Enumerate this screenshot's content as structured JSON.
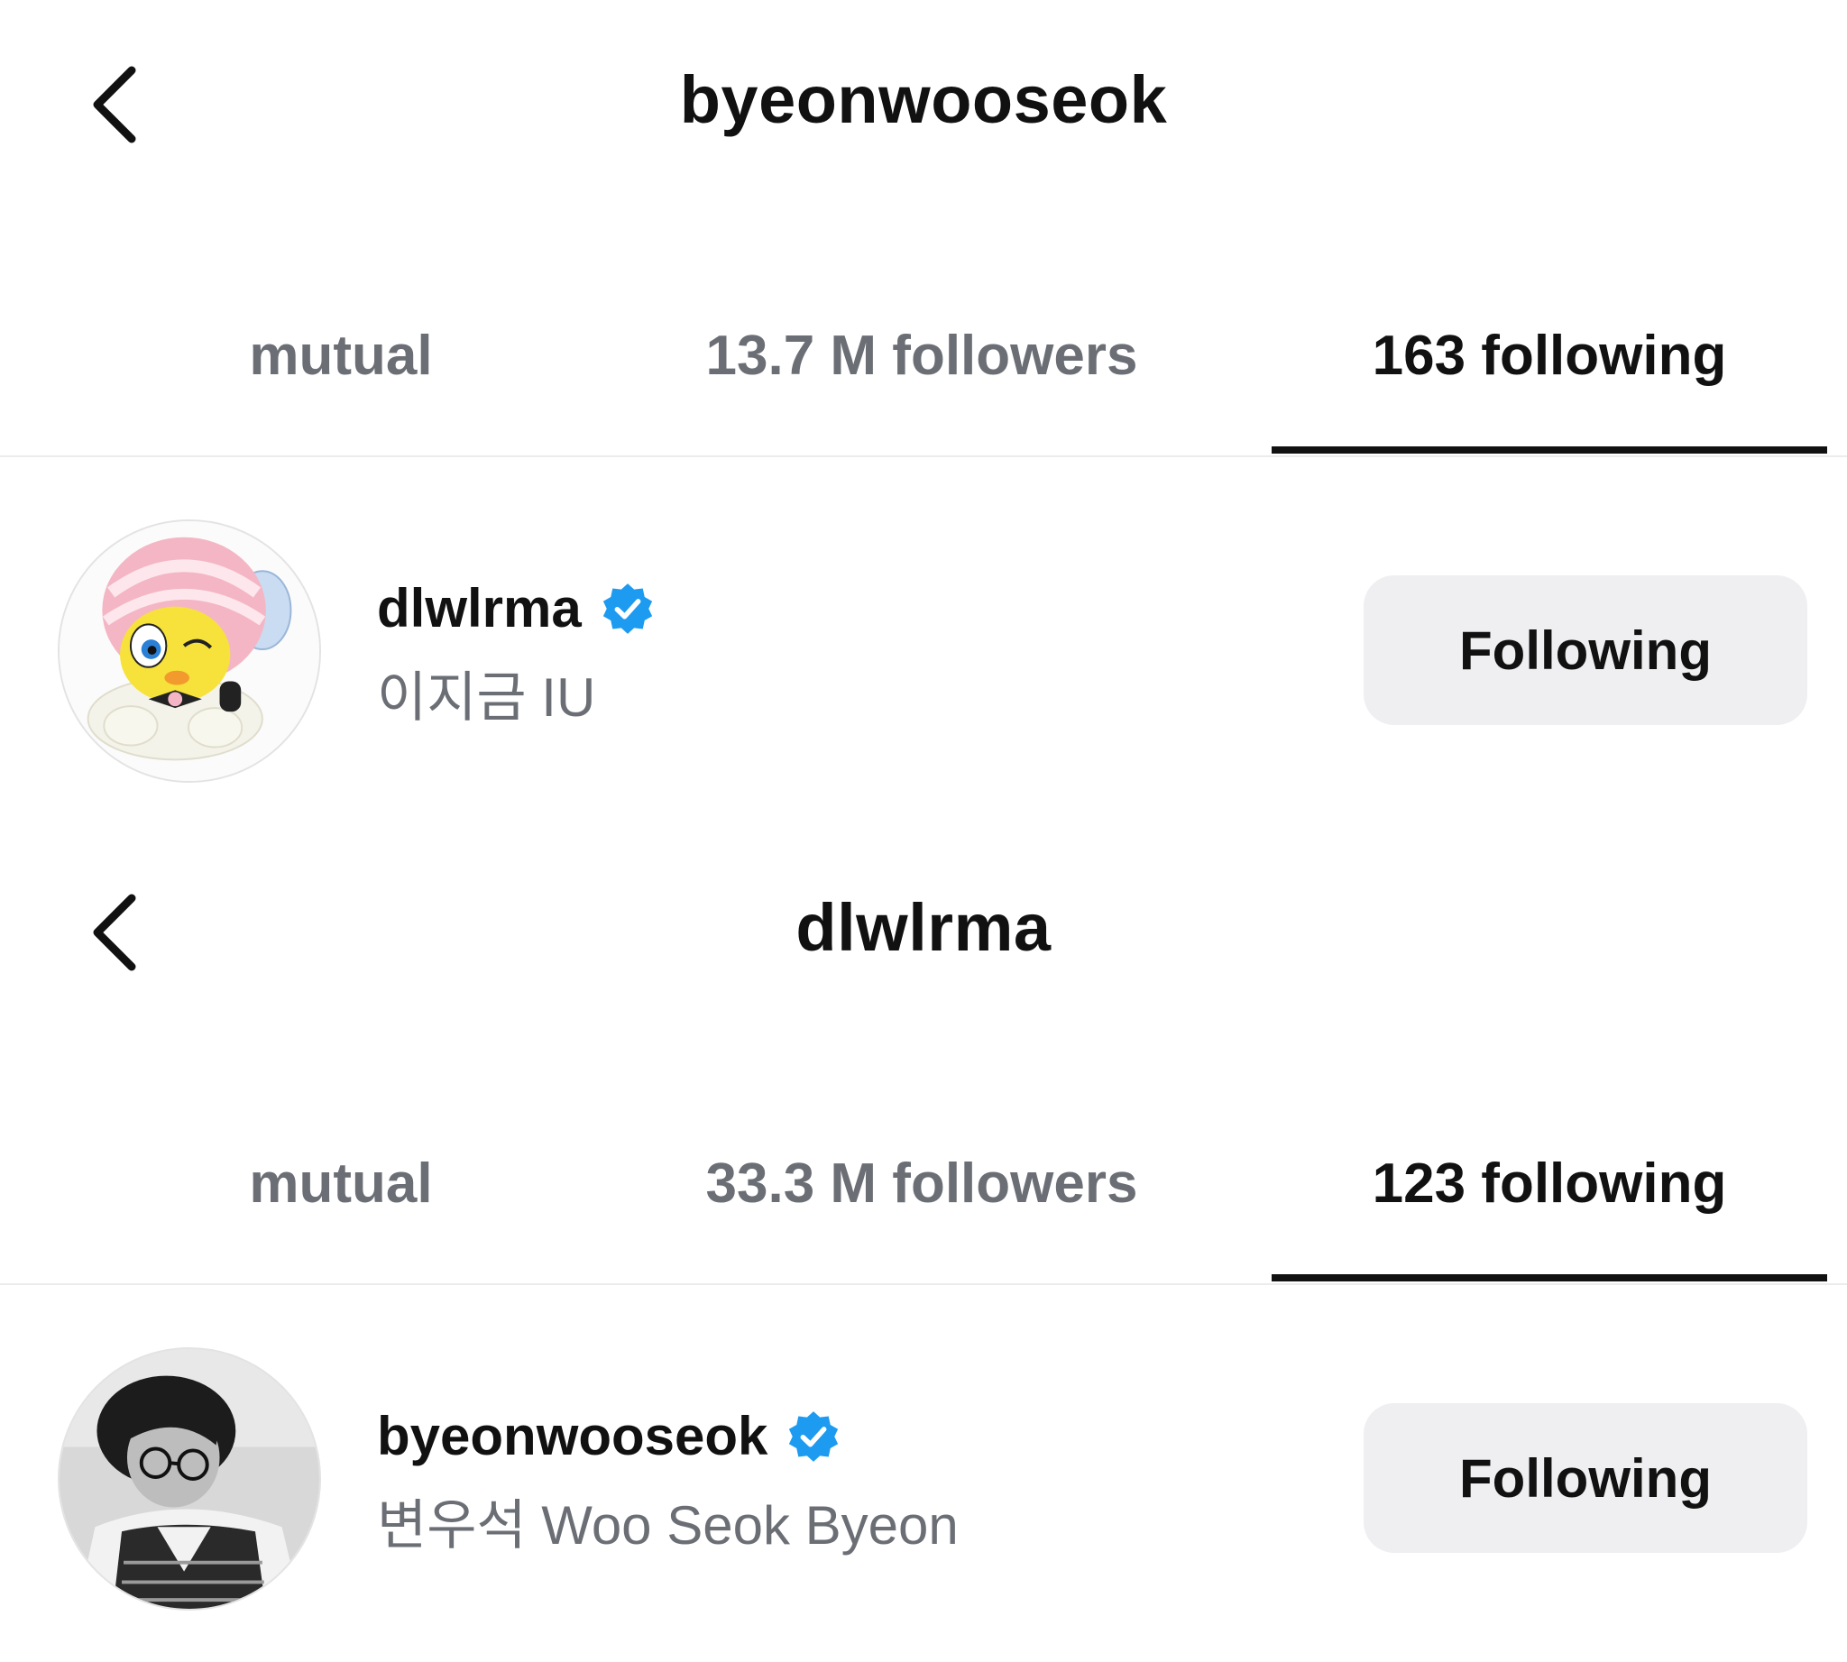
{
  "screens": [
    {
      "header": {
        "title": "byeonwooseok"
      },
      "tabs": [
        {
          "label": "mutual",
          "active": false
        },
        {
          "label": "13.7 M followers",
          "active": false
        },
        {
          "label": "163 following",
          "active": true
        }
      ],
      "list": [
        {
          "username": "dlwlrma",
          "verified": true,
          "full_name": "이지금 IU",
          "button_label": "Following",
          "avatar_icon": "cartoon-bird-avatar"
        }
      ]
    },
    {
      "header": {
        "title": "dlwlrma"
      },
      "tabs": [
        {
          "label": "mutual",
          "active": false
        },
        {
          "label": "33.3 M followers",
          "active": false
        },
        {
          "label": "123 following",
          "active": true
        }
      ],
      "list": [
        {
          "username": "byeonwooseok",
          "verified": true,
          "full_name": "변우석  Woo Seok Byeon",
          "button_label": "Following",
          "avatar_icon": "monochrome-portrait-avatar"
        }
      ]
    }
  ],
  "icons": {
    "back": "chevron-left-icon",
    "verified": "verified-badge-icon"
  },
  "colors": {
    "verified_blue": "#1d9bf0",
    "muted_text": "#6b6f75",
    "button_bg": "#efeff2",
    "divider": "#ececec"
  }
}
